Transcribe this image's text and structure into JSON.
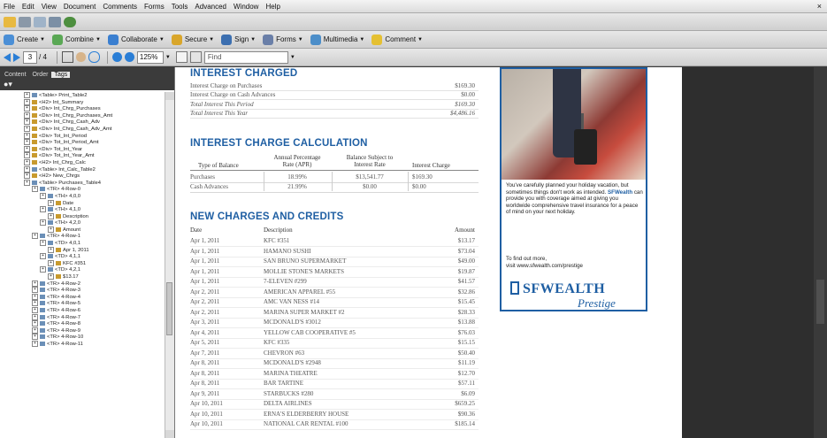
{
  "menu": [
    "File",
    "Edit",
    "View",
    "Document",
    "Comments",
    "Forms",
    "Tools",
    "Advanced",
    "Window",
    "Help"
  ],
  "close_glyph": "×",
  "toolbar2": [
    {
      "label": "Create",
      "icon": "create-icon",
      "color": "#4b8fd6"
    },
    {
      "label": "Combine",
      "icon": "combine-icon",
      "color": "#5aa855"
    },
    {
      "label": "Collaborate",
      "icon": "collaborate-icon",
      "color": "#3a7fd0"
    },
    {
      "label": "Secure",
      "icon": "lock-icon",
      "color": "#d9a62b"
    },
    {
      "label": "Sign",
      "icon": "pen-icon",
      "color": "#3c6fb0"
    },
    {
      "label": "Forms",
      "icon": "forms-icon",
      "color": "#6a7fa8"
    },
    {
      "label": "Multimedia",
      "icon": "multimedia-icon",
      "color": "#4c8ec9"
    },
    {
      "label": "Comment",
      "icon": "comment-icon",
      "color": "#e5c032"
    }
  ],
  "nav": {
    "page": "3",
    "of": "/ 4",
    "zoom": "125%",
    "find_placeholder": "Find"
  },
  "panel": {
    "tabs": [
      "Content",
      "Order",
      "Tags"
    ],
    "active_tab": "Tags"
  },
  "tree": [
    {
      "indent": 3,
      "icon": "tbl",
      "label": "<Table> Print_Table2"
    },
    {
      "indent": 3,
      "icon": "tag",
      "label": "<H2> Int_Summary"
    },
    {
      "indent": 3,
      "icon": "tag",
      "label": "<Div> Int_Chrg_Purchases"
    },
    {
      "indent": 3,
      "icon": "tag",
      "label": "<Div> Int_Chrg_Purchases_Amt"
    },
    {
      "indent": 3,
      "icon": "tag",
      "label": "<Div> Int_Chrg_Cash_Adv"
    },
    {
      "indent": 3,
      "icon": "tag",
      "label": "<Div> Int_Chrg_Cash_Adv_Amt"
    },
    {
      "indent": 3,
      "icon": "tag",
      "label": "<Div> Tot_Int_Period"
    },
    {
      "indent": 3,
      "icon": "tag",
      "label": "<Div> Tot_Int_Period_Amt"
    },
    {
      "indent": 3,
      "icon": "tag",
      "label": "<Div> Tot_Int_Year"
    },
    {
      "indent": 3,
      "icon": "tag",
      "label": "<Div> Tot_Int_Year_Amt"
    },
    {
      "indent": 3,
      "icon": "tag",
      "label": "<H2> Int_Chrg_Calc"
    },
    {
      "indent": 3,
      "icon": "tbl",
      "label": "<Table> Int_Calc_Table2"
    },
    {
      "indent": 3,
      "icon": "tag",
      "label": "<H2> New_Chrgs"
    },
    {
      "indent": 3,
      "icon": "tbl",
      "label": "<Table> Purchases_Table4"
    },
    {
      "indent": 4,
      "icon": "tbl",
      "label": "<TR> 4-Row-0"
    },
    {
      "indent": 5,
      "icon": "tbl",
      "label": "<TH> 4,0,0"
    },
    {
      "indent": 6,
      "icon": "tag",
      "label": "Date"
    },
    {
      "indent": 5,
      "icon": "tbl",
      "label": "<TH> 4,1,0"
    },
    {
      "indent": 6,
      "icon": "tag",
      "label": "Description"
    },
    {
      "indent": 5,
      "icon": "tbl",
      "label": "<TH> 4,2,0"
    },
    {
      "indent": 6,
      "icon": "tag",
      "label": "Amount"
    },
    {
      "indent": 4,
      "icon": "tbl",
      "label": "<TR> 4-Row-1"
    },
    {
      "indent": 5,
      "icon": "tbl",
      "label": "<TD> 4,0,1"
    },
    {
      "indent": 6,
      "icon": "tag",
      "label": "Apr 1, 2011"
    },
    {
      "indent": 5,
      "icon": "tbl",
      "label": "<TD> 4,1,1"
    },
    {
      "indent": 6,
      "icon": "tag",
      "label": "KFC #351"
    },
    {
      "indent": 5,
      "icon": "tbl",
      "label": "<TD> 4,2,1"
    },
    {
      "indent": 6,
      "icon": "tag",
      "label": "$13.17"
    },
    {
      "indent": 4,
      "icon": "tbl",
      "label": "<TR> 4-Row-2"
    },
    {
      "indent": 4,
      "icon": "tbl",
      "label": "<TR> 4-Row-3"
    },
    {
      "indent": 4,
      "icon": "tbl",
      "label": "<TR> 4-Row-4"
    },
    {
      "indent": 4,
      "icon": "tbl",
      "label": "<TR> 4-Row-5"
    },
    {
      "indent": 4,
      "icon": "tbl",
      "label": "<TR> 4-Row-6"
    },
    {
      "indent": 4,
      "icon": "tbl",
      "label": "<TR> 4-Row-7"
    },
    {
      "indent": 4,
      "icon": "tbl",
      "label": "<TR> 4-Row-8"
    },
    {
      "indent": 4,
      "icon": "tbl",
      "label": "<TR> 4-Row-9"
    },
    {
      "indent": 4,
      "icon": "tbl",
      "label": "<TR> 4-Row-10"
    },
    {
      "indent": 4,
      "icon": "tbl",
      "label": "<TR> 4-Row-11"
    }
  ],
  "doc": {
    "interest_charged": {
      "title": "INTEREST CHARGED",
      "rows": [
        {
          "label": "Interest  Charge  on  Purchases",
          "amount": "$169.30",
          "italic": false
        },
        {
          "label": "Interest  Charge  on  Cash  Advances",
          "amount": "$0.00",
          "italic": false
        },
        {
          "label": "Total Interest This Period",
          "amount": "$169.30",
          "italic": true
        },
        {
          "label": "Total Interest This Year",
          "amount": "$4,486.16",
          "italic": true
        }
      ]
    },
    "calc": {
      "title": "INTEREST CHARGE CALCULATION",
      "headers": {
        "type": "Type of Balance",
        "apr1": "Annual Percentage",
        "apr2": "Rate (APR)",
        "bal1": "Balance  Subject  to",
        "bal2": "Interest Rate",
        "charge": "Interest Charge"
      },
      "rows": [
        {
          "type": "Purchases",
          "apr": "18.99%",
          "bal": "$13,541.77",
          "charge": "$169.30"
        },
        {
          "type": "Cash  Advances",
          "apr": "21.99%",
          "bal": "$0.00",
          "charge": "$0.00"
        }
      ]
    },
    "new_charges": {
      "title": "NEW CHARGES AND CREDITS",
      "headers": {
        "date": "Date",
        "desc": "Description",
        "amount": "Amount"
      },
      "rows": [
        {
          "date": "Apr 1, 2011",
          "desc": "KFC #351",
          "amount": "$13.17"
        },
        {
          "date": "Apr 1, 2011",
          "desc": "HAMANO SUSHI",
          "amount": "$73.04"
        },
        {
          "date": "Apr 1, 2011",
          "desc": "SAN BRUNO SUPERMARKET",
          "amount": "$49.00"
        },
        {
          "date": "Apr 1, 2011",
          "desc": "MOLLIE STONE'S  MARKETS",
          "amount": "$19.87"
        },
        {
          "date": "Apr 1, 2011",
          "desc": "7-ELEVEN #299",
          "amount": "$41.57"
        },
        {
          "date": "Apr 2, 2011",
          "desc": "AMERICAN APPAREL #55",
          "amount": "$32.86"
        },
        {
          "date": "Apr 2, 2011",
          "desc": "AMC VAN NESS #14",
          "amount": "$15.45"
        },
        {
          "date": "Apr 2, 2011",
          "desc": "MARINA SUPER  MARKET #2",
          "amount": "$28.33"
        },
        {
          "date": "Apr 3, 2011",
          "desc": "MCDONALD'S #3012",
          "amount": "$13.88"
        },
        {
          "date": "Apr 4, 2011",
          "desc": "YELLOW CAB COOPERATIVE  #5",
          "amount": "$76.03"
        },
        {
          "date": "Apr 5, 2011",
          "desc": "KFC #335",
          "amount": "$15.15"
        },
        {
          "date": "Apr 7, 2011",
          "desc": "CHEVRON #63",
          "amount": "$50.40"
        },
        {
          "date": "Apr 8, 2011",
          "desc": "MCDONALD'S #2948",
          "amount": "$11.19"
        },
        {
          "date": "Apr 8, 2011",
          "desc": "MARINA THEATRE",
          "amount": "$12.70"
        },
        {
          "date": "Apr 8, 2011",
          "desc": "BAR TARTINE",
          "amount": "$57.11"
        },
        {
          "date": "Apr 9, 2011",
          "desc": "STARBUCKS #280",
          "amount": "$6.09"
        },
        {
          "date": "Apr 10, 2011",
          "desc": "DELTA AIRLINES",
          "amount": "$659.25"
        },
        {
          "date": "Apr 10, 2011",
          "desc": "ERNA'S ELDERBERRY  HOUSE",
          "amount": "$90.36"
        },
        {
          "date": "Apr 10, 2011",
          "desc": "NATIONAL CAR RENTAL #100",
          "amount": "$185.14"
        }
      ]
    },
    "ad": {
      "para1_pre": "You've carefully planned your holiday vacation, but sometimes things don't work as intended. ",
      "para1_brand": "SFWealth",
      "para1_post": " can provide you with coverage aimed at giving you worldwide comprehensive travel insurance for a peace of mind on your next holiday.",
      "para2_line1": "To find out more,",
      "para2_line2": "visit www.sfwealth.com/prestige",
      "brand": "SFWEALTH",
      "tagline": "Prestige"
    }
  }
}
